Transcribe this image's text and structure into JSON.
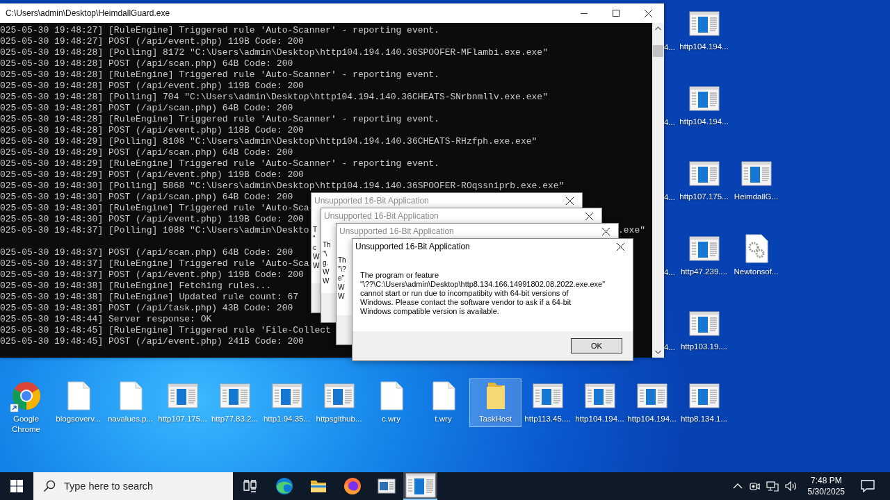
{
  "console_window": {
    "title": "C:\\Users\\admin\\Desktop\\HeimdallGuard.exe",
    "lines": [
      {
        "kind": "log",
        "text": "025-05-30 19:48:27] [RuleEngine] Triggered rule 'Auto-Scanner' - reporting event."
      },
      {
        "kind": "log",
        "text": "025-05-30 19:48:27] POST (/api/event.php) 119B Code: 200"
      },
      {
        "kind": "log",
        "text": "025-05-30 19:48:28] [Polling] 8172 \"C:\\Users\\admin\\Desktop\\http104.194.140.36SPOOFER-MFlambi.exe.exe\""
      },
      {
        "kind": "log",
        "text": "025-05-30 19:48:28] POST (/api/scan.php) 64B Code: 200"
      },
      {
        "kind": "log",
        "text": "025-05-30 19:48:28] [RuleEngine] Triggered rule 'Auto-Scanner' - reporting event."
      },
      {
        "kind": "log",
        "text": "025-05-30 19:48:28] POST (/api/event.php) 119B Code: 200"
      },
      {
        "kind": "log",
        "text": "025-05-30 19:48:28] [Polling] 704 \"C:\\Users\\admin\\Desktop\\http104.194.140.36CHEATS-SNrbnmllv.exe.exe\""
      },
      {
        "kind": "log",
        "text": "025-05-30 19:48:28] POST (/api/scan.php) 64B Code: 200"
      },
      {
        "kind": "log",
        "text": "025-05-30 19:48:28] [RuleEngine] Triggered rule 'Auto-Scanner' - reporting event."
      },
      {
        "kind": "log",
        "text": "025-05-30 19:48:28] POST (/api/event.php) 118B Code: 200"
      },
      {
        "kind": "log",
        "text": "025-05-30 19:48:29] [Polling] 8108 \"C:\\Users\\admin\\Desktop\\http104.194.140.36CHEATS-RHzfph.exe.exe\""
      },
      {
        "kind": "log",
        "text": "025-05-30 19:48:29] POST (/api/scan.php) 64B Code: 200"
      },
      {
        "kind": "log",
        "text": "025-05-30 19:48:29] [RuleEngine] Triggered rule 'Auto-Scanner' - reporting event."
      },
      {
        "kind": "log",
        "text": "025-05-30 19:48:29] POST (/api/event.php) 119B Code: 200"
      },
      {
        "kind": "log",
        "text": "025-05-30 19:48:30] [Polling] 5868 \"C:\\Users\\admin\\Desktop\\http104.194.140.36SPOOFER-ROqssniprb.exe.exe\""
      },
      {
        "kind": "log",
        "text": "025-05-30 19:48:30] POST (/api/scan.php) 64B Code: 200"
      },
      {
        "kind": "log",
        "text": "025-05-30 19:48:30] [RuleEngine] Triggered rule 'Auto-Sca"
      },
      {
        "kind": "log",
        "text": "025-05-30 19:48:30] POST (/api/event.php) 119B Code: 200"
      },
      {
        "kind": "log",
        "text": "025-05-30 19:48:37] [Polling] 1088 \"C:\\Users\\admin\\Deskto",
        "tail": ".exe\""
      },
      {
        "kind": "blank"
      },
      {
        "kind": "log",
        "text": "025-05-30 19:48:37] POST (/api/scan.php) 64B Code: 200"
      },
      {
        "kind": "log",
        "text": "025-05-30 19:48:37] [RuleEngine] Triggered rule 'Auto-Sca"
      },
      {
        "kind": "log",
        "text": "025-05-30 19:48:37] POST (/api/event.php) 119B Code: 200"
      },
      {
        "kind": "log",
        "text": "025-05-30 19:48:38] [RuleEngine] Fetching rules..."
      },
      {
        "kind": "log",
        "text": "025-05-30 19:48:38] [RuleEngine] Updated rule count: 67"
      },
      {
        "kind": "log",
        "text": "025-05-30 19:48:38] POST (/api/task.php) 43B Code: 200"
      },
      {
        "kind": "log",
        "text": "025-05-30 19:48:44] Server response: OK"
      },
      {
        "kind": "log",
        "text": "025-05-30 19:48:45] [RuleEngine] Triggered rule 'File-Collect"
      },
      {
        "kind": "log",
        "text": "025-05-30 19:48:45] POST (/api/event.php) 241B Code: 200"
      }
    ]
  },
  "dialogs": [
    {
      "kind": "stacked",
      "title": "Unsupported 16-Bit Application",
      "fragments": [
        "T",
        "\"",
        "c",
        "W",
        "W"
      ]
    },
    {
      "kind": "stacked",
      "title": "Unsupported 16-Bit Application",
      "fragments": [
        "Th",
        "\"\\",
        "g.",
        "W",
        "W"
      ]
    },
    {
      "kind": "stacked",
      "title": "Unsupported 16-Bit Application",
      "fragments": [
        "Th",
        "\"\\?",
        "e\"",
        "W",
        "W"
      ]
    },
    {
      "kind": "front",
      "title": "Unsupported 16-Bit Application",
      "message": [
        "The program or feature",
        "\"\\??\\C:\\Users\\admin\\Desktop\\http8.134.166.14991802.08.2022.exe.exe\"",
        "cannot start or run due to incompatibity with 64-bit versions of",
        "Windows. Please contact the software vendor to ask if a 64-bit",
        "Windows compatible version is available."
      ],
      "button": "OK"
    }
  ],
  "desktop_right": {
    "cut_labels": [
      "4...",
      "4...",
      "4...",
      "4...",
      "4..."
    ],
    "column_1": [
      {
        "label": "http104.194...",
        "kind": "app",
        "selected": false
      },
      {
        "label": "http104.194...",
        "kind": "app",
        "selected": false
      },
      {
        "label": "http107.175...",
        "kind": "app",
        "selected": false
      },
      {
        "label": "http47.239....",
        "kind": "app",
        "selected": false
      },
      {
        "label": "http103.19....",
        "kind": "app",
        "selected": false
      }
    ],
    "column_2": [
      {
        "label": "HeimdallG...",
        "kind": "app",
        "selected": false
      },
      {
        "label": "Newtonsof...",
        "kind": "gear-file",
        "selected": false
      }
    ]
  },
  "desktop_bottom": [
    {
      "label": "Google Chrome",
      "kind": "chrome",
      "selected": false
    },
    {
      "label": "blogsoverv...",
      "kind": "file",
      "selected": false
    },
    {
      "label": "navalues.p...",
      "kind": "file",
      "selected": false
    },
    {
      "label": "http107.175...",
      "kind": "app",
      "selected": false
    },
    {
      "label": "http77.83.2...",
      "kind": "app",
      "selected": false
    },
    {
      "label": "http1.94.35...",
      "kind": "app",
      "selected": false
    },
    {
      "label": "httpsgithub...",
      "kind": "app",
      "selected": false
    },
    {
      "label": "c.wry",
      "kind": "file",
      "selected": false
    },
    {
      "label": "t.wry",
      "kind": "file",
      "selected": false
    },
    {
      "label": "TaskHost",
      "kind": "folder",
      "selected": true
    },
    {
      "label": "http113.45....",
      "kind": "app",
      "selected": false
    },
    {
      "label": "http104.194...",
      "kind": "app",
      "selected": false
    },
    {
      "label": "http104.194...",
      "kind": "app",
      "selected": false
    },
    {
      "label": "http8.134.1...",
      "kind": "app",
      "selected": false
    }
  ],
  "taskbar": {
    "search_placeholder": "Type here to search",
    "apps": [
      {
        "kind": "task-view",
        "active": false
      },
      {
        "kind": "edge",
        "active": false
      },
      {
        "kind": "explorer",
        "active": false
      },
      {
        "kind": "firefox",
        "active": false
      },
      {
        "kind": "console",
        "active": false
      },
      {
        "kind": "app",
        "active": true
      }
    ],
    "clock": {
      "time": "7:48 PM",
      "date": "5/30/2025"
    }
  }
}
